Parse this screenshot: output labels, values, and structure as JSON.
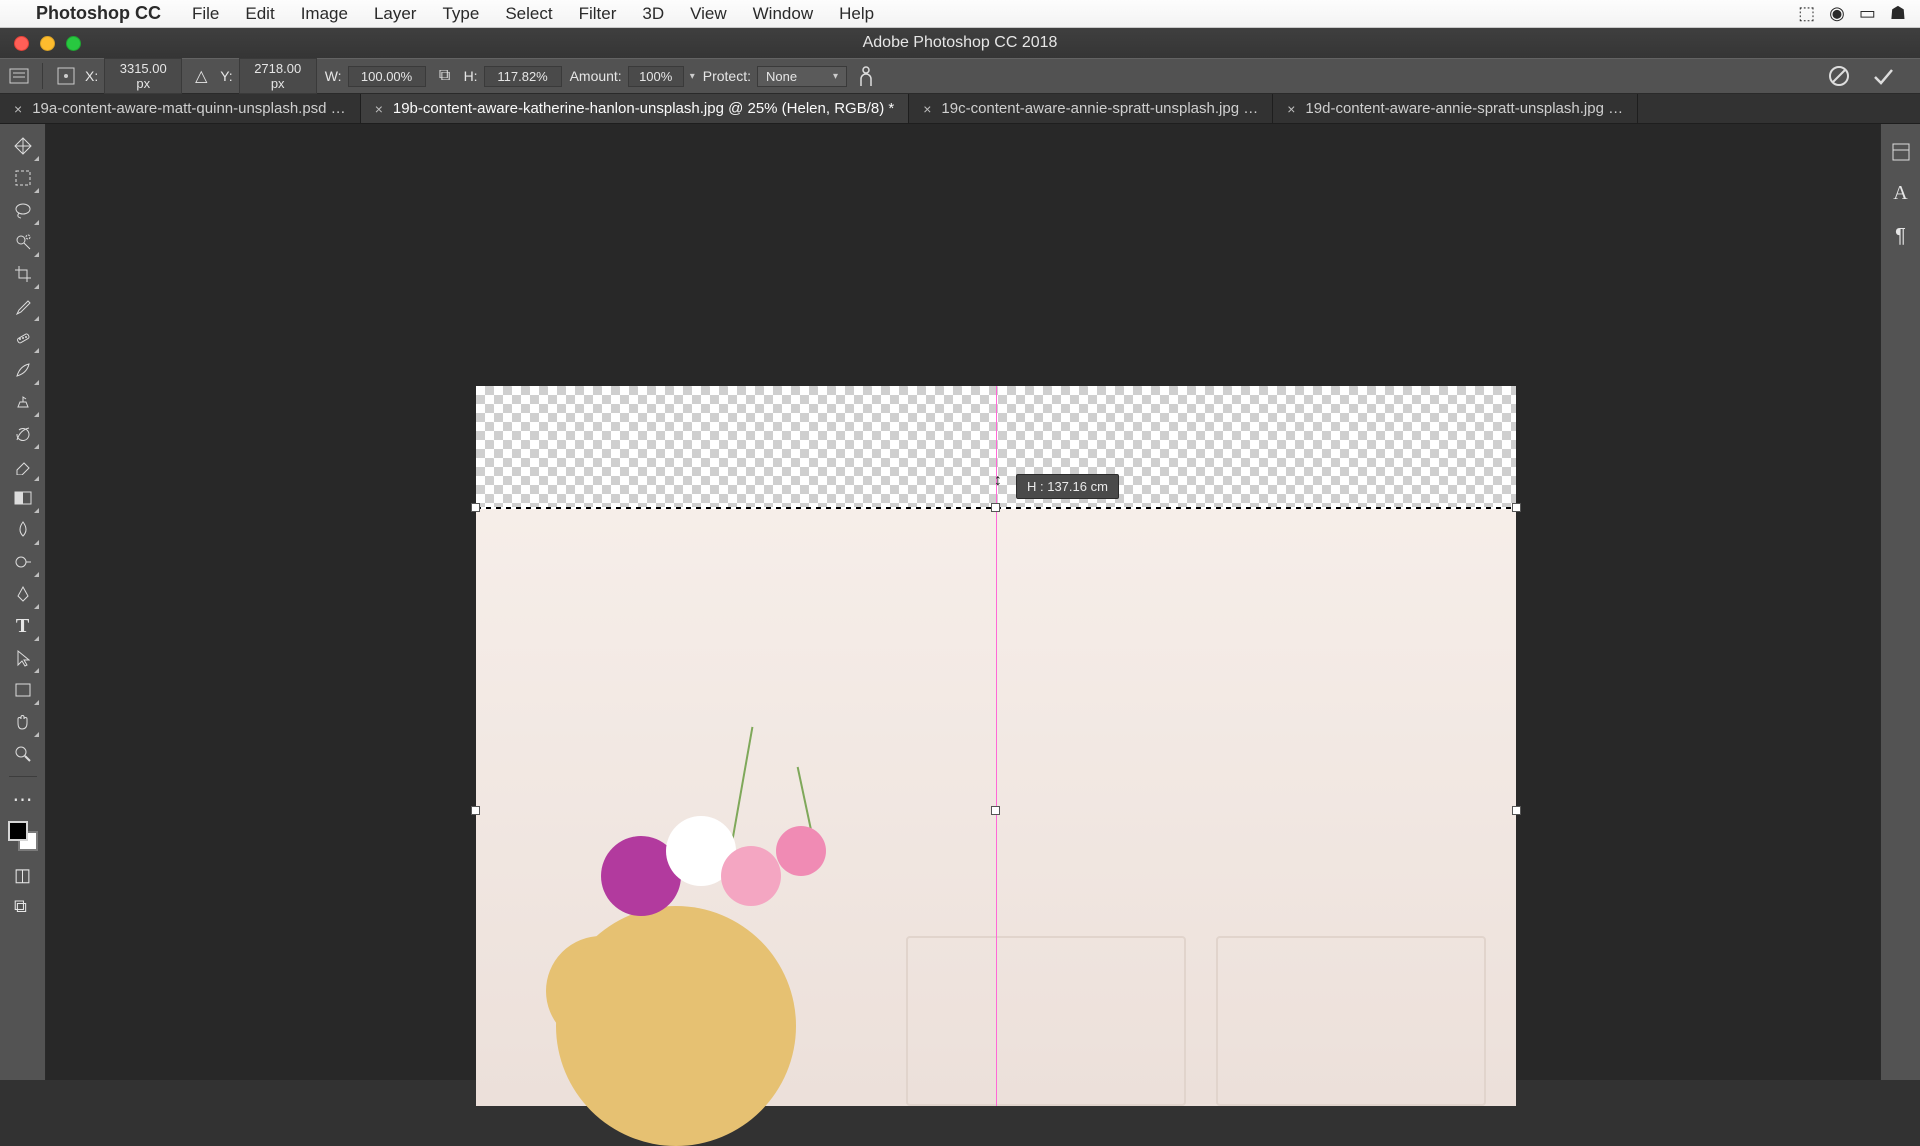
{
  "menubar": {
    "app_name": "Photoshop CC",
    "items": [
      "File",
      "Edit",
      "Image",
      "Layer",
      "Type",
      "Select",
      "Filter",
      "3D",
      "View",
      "Window",
      "Help"
    ]
  },
  "window": {
    "title": "Adobe Photoshop CC 2018"
  },
  "options": {
    "x_label": "X:",
    "x_value": "3315.00 px",
    "y_label": "Y:",
    "y_value": "2718.00 px",
    "w_label": "W:",
    "w_value": "100.00%",
    "h_label": "H:",
    "h_value": "117.82%",
    "amount_label": "Amount:",
    "amount_value": "100%",
    "protect_label": "Protect:",
    "protect_value": "None"
  },
  "tabs": [
    {
      "label": "19a-content-aware-matt-quinn-unsplash.psd …",
      "active": false
    },
    {
      "label": "19b-content-aware-katherine-hanlon-unsplash.jpg @ 25% (Helen, RGB/8) *",
      "active": true
    },
    {
      "label": "19c-content-aware-annie-spratt-unsplash.jpg …",
      "active": false
    },
    {
      "label": "19d-content-aware-annie-spratt-unsplash.jpg …",
      "active": false
    }
  ],
  "readout": {
    "text": "H : 137.16 cm"
  }
}
